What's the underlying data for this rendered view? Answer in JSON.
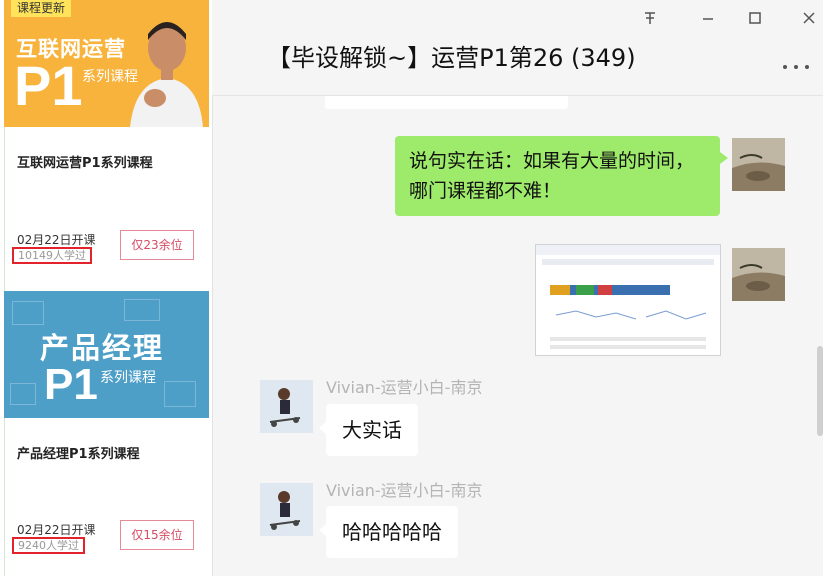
{
  "window": {
    "title": "【毕设解锁~】运营P1第26 (349)",
    "pin_icon": "pin-icon",
    "minimize_icon": "minimize-icon",
    "maximize_icon": "maximize-icon",
    "close_icon": "close-icon",
    "more_label": "..."
  },
  "courses": [
    {
      "tag": "课程更新",
      "banner_title": "互联网运营",
      "banner_p1": "P1",
      "banner_sub": "系列课程",
      "title": "互联网运营P1系列课程",
      "date": "02月22日开课",
      "learned": "10149人学过",
      "seats": "仅23余位"
    },
    {
      "banner_title": "产品经理",
      "banner_p1": "P1",
      "banner_sub": "系列课程",
      "title": "产品经理P1系列课程",
      "date": "02月22日开课",
      "learned": "9240人学过",
      "seats": "仅15余位"
    }
  ],
  "messages": [
    {
      "type": "self-text",
      "text": "说句实在话：如果有大量的时间，哪门课程都不难！"
    },
    {
      "type": "self-image",
      "description_icon": "screenshot-thumbnail"
    },
    {
      "type": "other-text",
      "sender": "Vivian-运营小白-南京",
      "text": "大实话"
    },
    {
      "type": "other-text",
      "sender": "Vivian-运营小白-南京",
      "text": "哈哈哈哈哈"
    }
  ],
  "colors": {
    "self_bubble": "#9eea6a",
    "other_bubble": "#ffffff",
    "banner1": "#f7b33c",
    "banner2": "#4e9fc8",
    "highlight_box": "#e2232b",
    "seats_text": "#d64b63"
  }
}
